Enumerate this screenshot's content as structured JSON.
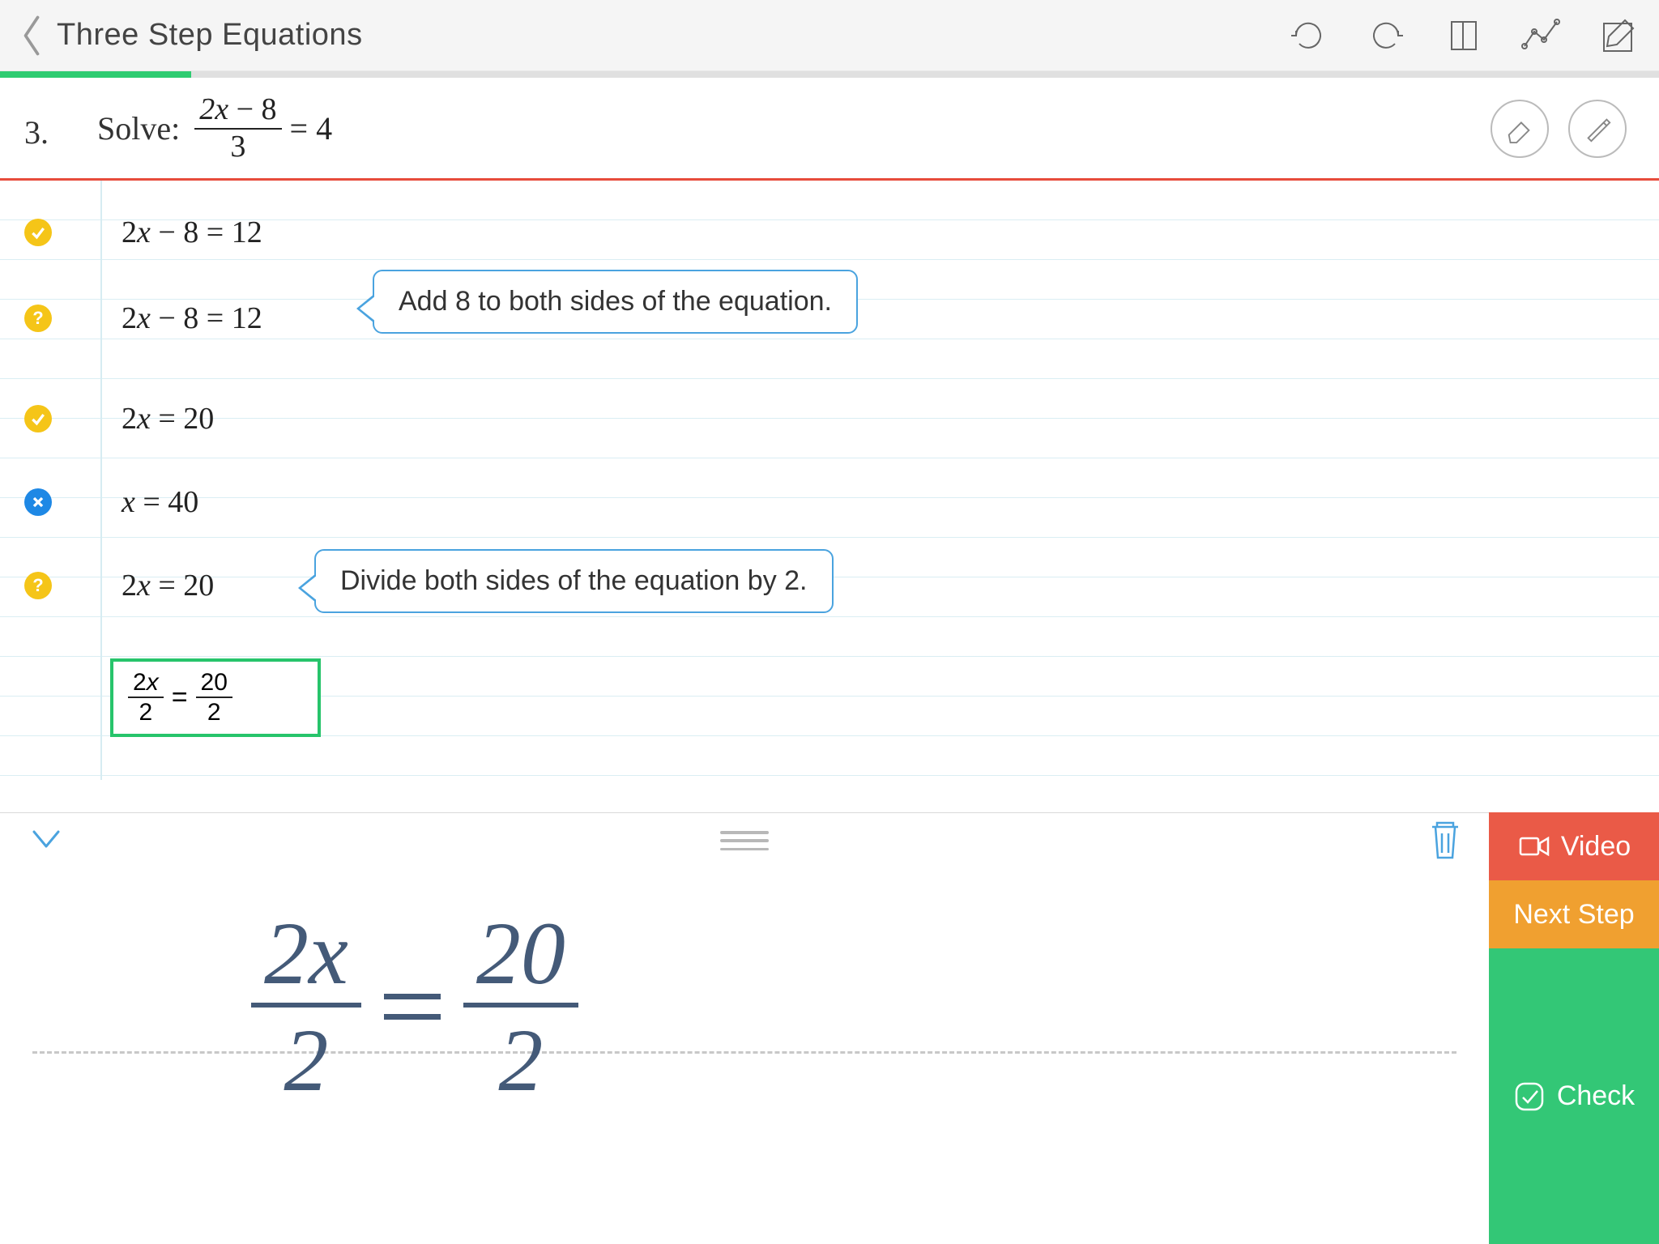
{
  "header": {
    "title": "Three Step Equations"
  },
  "progress": {
    "percent": 11.5
  },
  "problem": {
    "number": "3.",
    "label": "Solve:",
    "frac_num": "2x − 8",
    "frac_den": "3",
    "rhs": " = 4"
  },
  "steps": [
    {
      "status": "check",
      "expr": "2x − 8 = 12"
    },
    {
      "status": "hint",
      "expr": "2x − 8 = 12",
      "hint": "Add 8 to both sides of the equation."
    },
    {
      "status": "check",
      "expr": "2x = 20"
    },
    {
      "status": "wrong",
      "expr": "x = 40"
    },
    {
      "status": "hint",
      "expr": "2x = 20",
      "hint": "Divide both sides of the equation by 2."
    }
  ],
  "current_input": {
    "left_num": "2x",
    "left_den": "2",
    "right_num": "20",
    "right_den": "2"
  },
  "handwriting": {
    "left_num": "2x",
    "left_den": "2",
    "right_num": "20",
    "right_den": "2"
  },
  "actions": {
    "video": "Video",
    "next": "Next Step",
    "check": "Check"
  }
}
